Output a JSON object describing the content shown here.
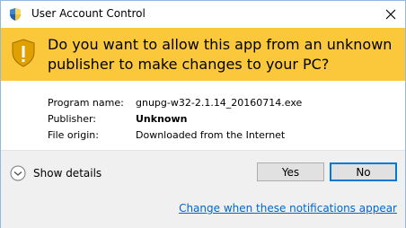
{
  "window": {
    "title": "User Account Control",
    "close_icon": "close-icon"
  },
  "banner": {
    "question": "Do you want to allow this app from an unknown publisher to make changes to your PC?",
    "icon": "shield-icon",
    "color": "#fbc83c"
  },
  "info": {
    "program_label": "Program name:",
    "program_value": "gnupg-w32-2.1.14_20160714.exe",
    "publisher_label": "Publisher:",
    "publisher_value": "Unknown",
    "origin_label": "File origin:",
    "origin_value": "Downloaded from the Internet"
  },
  "footer": {
    "show_details": "Show details",
    "yes_label": "Yes",
    "no_label": "No",
    "notifications_link": "Change when these notifications appear"
  }
}
